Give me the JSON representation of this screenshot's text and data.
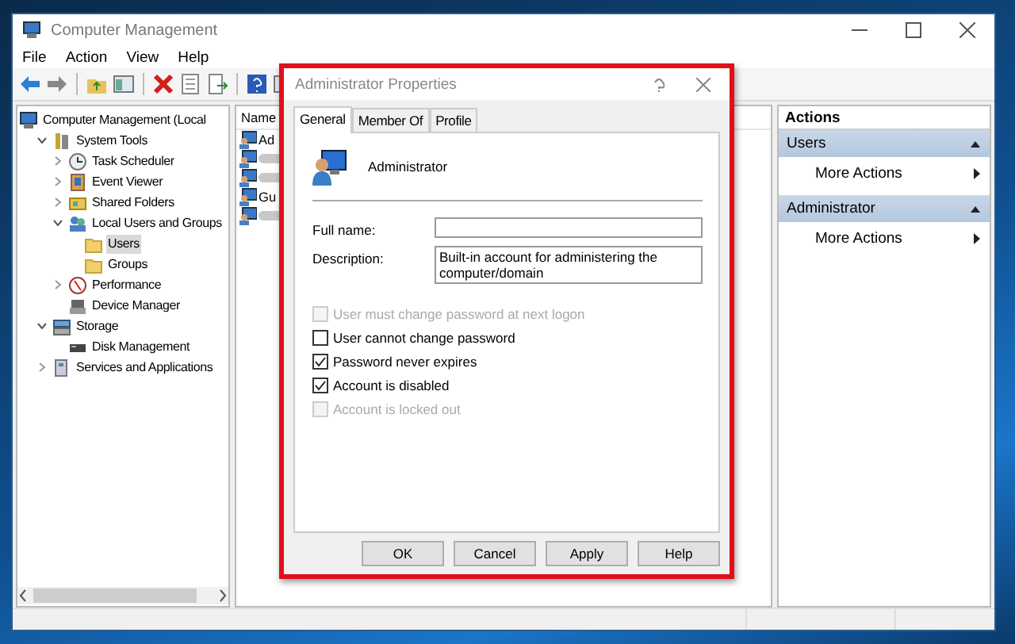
{
  "window": {
    "title": "Computer Management"
  },
  "menu": [
    "File",
    "Action",
    "View",
    "Help"
  ],
  "tree": [
    {
      "label": "Computer Management (Local",
      "selected": false,
      "children": [
        {
          "label": "System Tools",
          "expanded": true,
          "selected": false,
          "children": [
            {
              "label": "Task Scheduler",
              "expanded": false,
              "selected": false
            },
            {
              "label": "Event Viewer",
              "expanded": false,
              "selected": false
            },
            {
              "label": "Shared Folders",
              "expanded": false,
              "selected": false
            },
            {
              "label": "Local Users and Groups",
              "expanded": true,
              "selected": false,
              "children": [
                {
                  "label": "Users",
                  "selected": true
                },
                {
                  "label": "Groups",
                  "selected": false
                }
              ]
            },
            {
              "label": "Performance",
              "expanded": false,
              "selected": false
            },
            {
              "label": "Device Manager",
              "selected": false
            }
          ]
        },
        {
          "label": "Storage",
          "expanded": true,
          "selected": false,
          "children": [
            {
              "label": "Disk Management",
              "selected": false
            }
          ]
        },
        {
          "label": "Services and Applications",
          "expanded": false,
          "selected": false
        }
      ]
    }
  ],
  "list": {
    "column": "Name",
    "rows": [
      {
        "kind": "named",
        "name": "Ad"
      },
      {
        "kind": "blurred"
      },
      {
        "kind": "blurred"
      },
      {
        "kind": "named",
        "name": "Gu"
      },
      {
        "kind": "blurred"
      }
    ]
  },
  "actions": {
    "header": "Actions",
    "sections": [
      {
        "title": "Users",
        "items": [
          "More Actions"
        ]
      },
      {
        "title": "Administrator",
        "items": [
          "More Actions"
        ]
      }
    ]
  },
  "dialog": {
    "title": "Administrator Properties",
    "tabs": [
      {
        "label": "General",
        "selected": true
      },
      {
        "label": "Member Of",
        "selected": false
      },
      {
        "label": "Profile",
        "selected": false
      }
    ],
    "user": "Administrator",
    "fields": [
      {
        "label": "Full name:"
      },
      {
        "label": "Description:",
        "value": "Built-in account for administering the computer/domain"
      }
    ],
    "checkboxes": [
      {
        "label": "User must change password at next logon",
        "checked": false,
        "disabled": true
      },
      {
        "label": "User cannot change password",
        "checked": false,
        "disabled": false
      },
      {
        "label": "Password never expires",
        "checked": true,
        "disabled": false
      },
      {
        "label": "Account is disabled",
        "checked": true,
        "disabled": false
      },
      {
        "label": "Account is locked out",
        "checked": false,
        "disabled": true
      }
    ],
    "buttons": [
      "OK",
      "Cancel",
      "Apply",
      "Help"
    ]
  }
}
